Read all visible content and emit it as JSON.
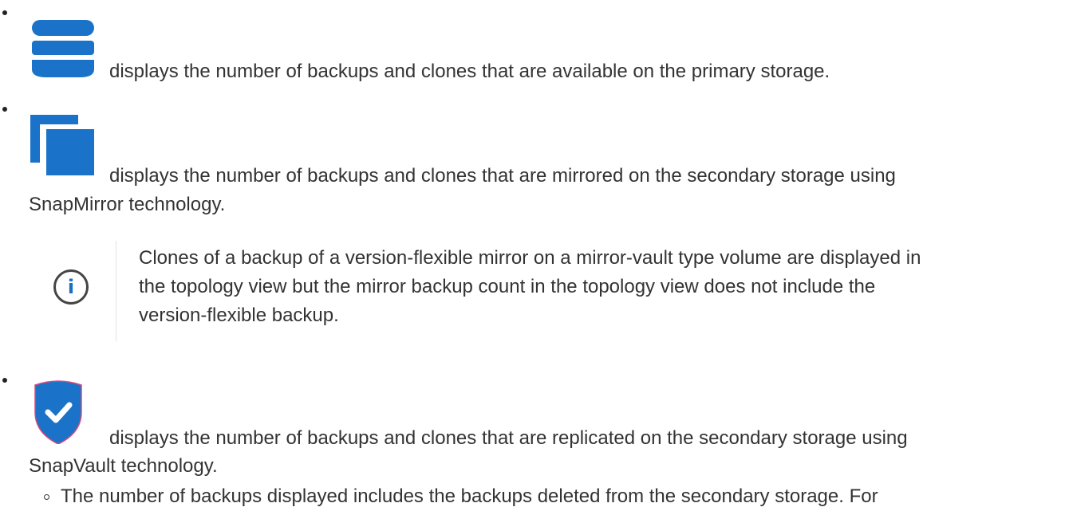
{
  "items": [
    {
      "icon": "database-icon",
      "text_line1": "displays the number of backups and clones that are available on the primary storage."
    },
    {
      "icon": "copy-icon",
      "text_line1": "displays the number of backups and clones that are mirrored on the secondary storage using",
      "text_line2": "SnapMirror technology."
    },
    {
      "icon": "shield-check-icon",
      "text_line1": "displays the number of backups and clones that are replicated on the secondary storage using",
      "text_line2": "SnapVault technology."
    }
  ],
  "note": {
    "icon": "info-icon",
    "glyph": "i",
    "line1": "Clones of a backup of a version-flexible mirror on a mirror-vault type volume are displayed in",
    "line2": "the topology view but the mirror backup count in the topology view does not include the",
    "line3": "version-flexible backup."
  },
  "sub_item": {
    "text": "The number of backups displayed includes the backups deleted from the secondary storage. For"
  },
  "colors": {
    "icon_blue": "#1a73c8",
    "text": "#333333"
  }
}
